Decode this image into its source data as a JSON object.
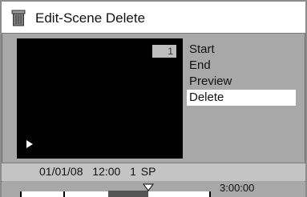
{
  "window": {
    "title": "Edit-Scene Delete",
    "title_icon": "trash-can-icon"
  },
  "preview": {
    "scene_number": "1",
    "play_icon": "play-icon"
  },
  "menu": {
    "items": [
      {
        "label": "Start",
        "selected": false
      },
      {
        "label": "End",
        "selected": false
      },
      {
        "label": "Preview",
        "selected": false
      },
      {
        "label": "Delete",
        "selected": true
      }
    ]
  },
  "status": {
    "date": "01/01/08",
    "time": "12:00",
    "mode": "1 SP"
  },
  "timeline": {
    "duration": "3:00:00",
    "marker_icon": "position-marker-icon"
  }
}
